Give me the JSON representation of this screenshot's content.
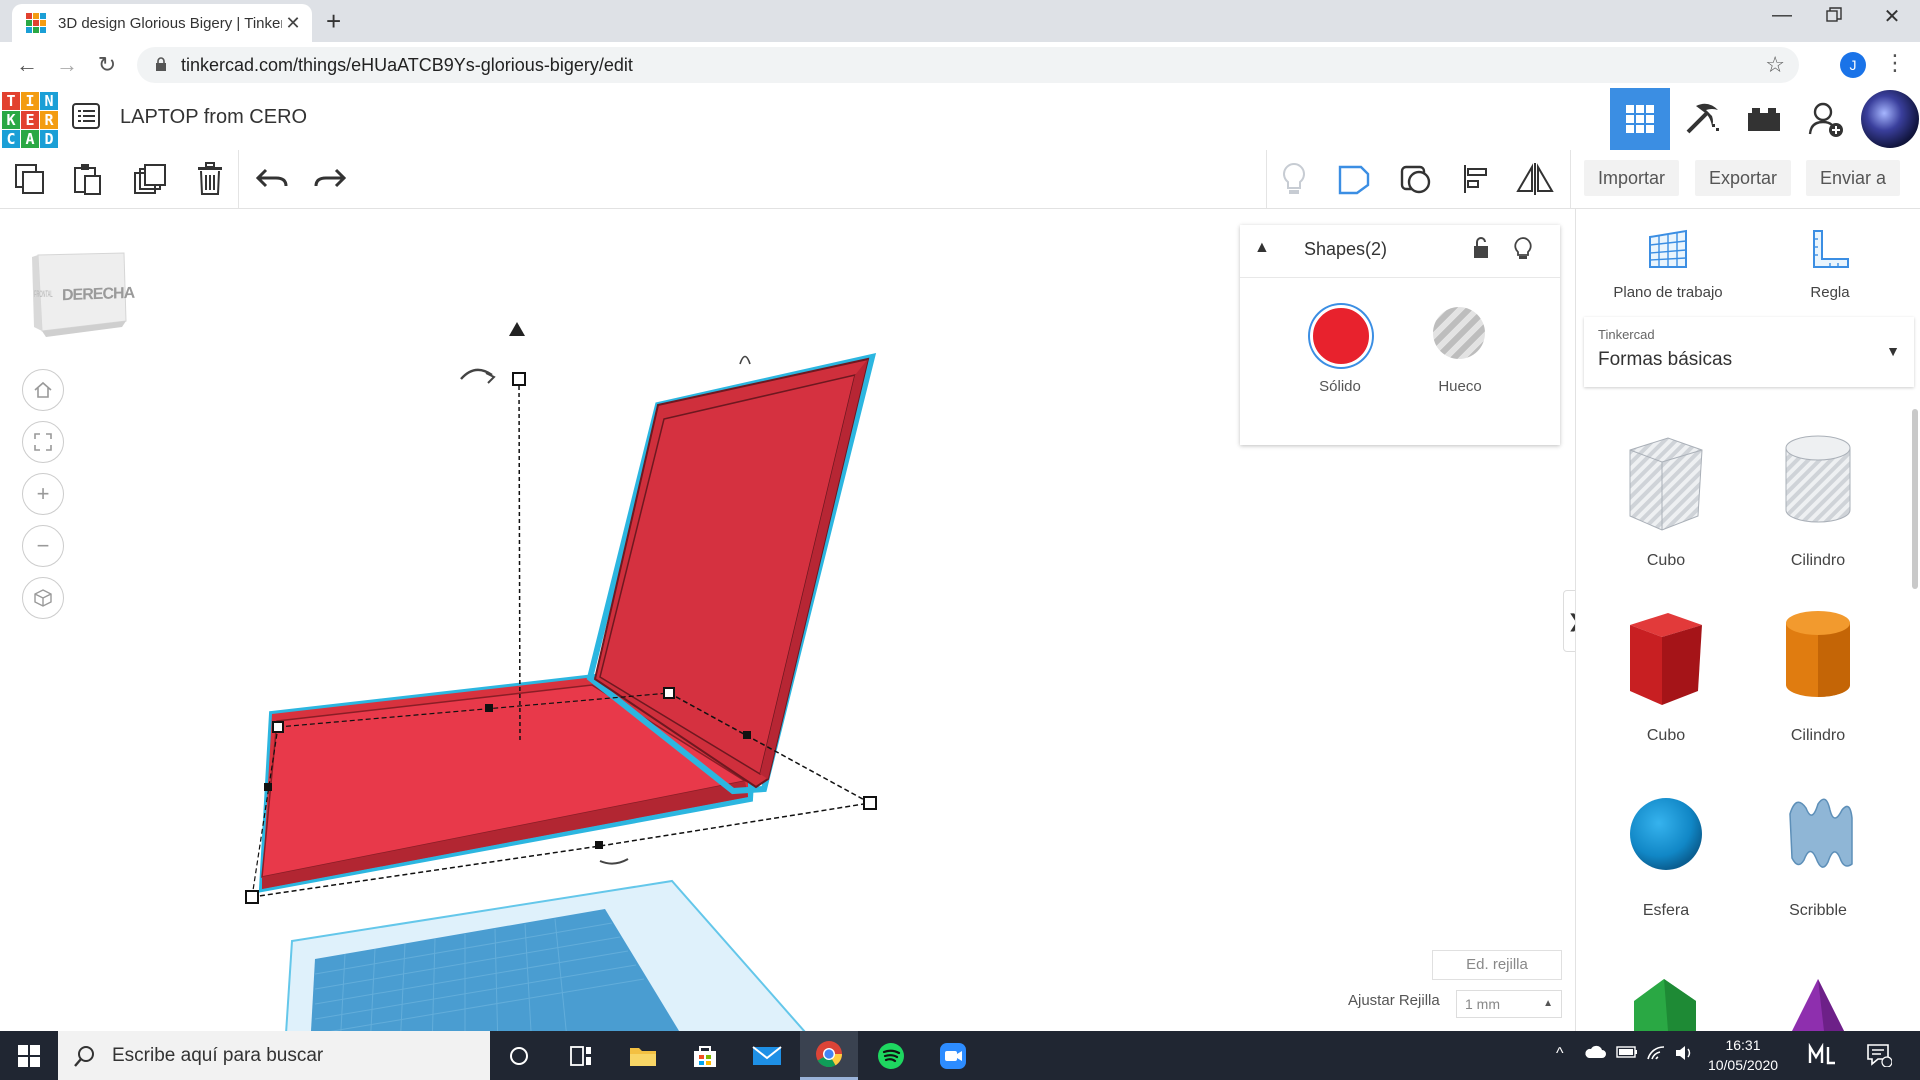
{
  "browser": {
    "tab_title": "3D design Glorious Bigery | Tinkercad",
    "url": "tinkercad.com/things/eHUaATCB9Ys-glorious-bigery/edit",
    "profile_initial": "J"
  },
  "app": {
    "logo_letters": [
      "T",
      "I",
      "N",
      "K",
      "E",
      "R",
      "C",
      "A",
      "D"
    ],
    "logo_colors": [
      "#e2412f",
      "#f39c12",
      "#1b9fd6",
      "#2aa844",
      "#e2412f",
      "#f39c12",
      "#1b9fd6",
      "#2aa844",
      "#1b9fd6"
    ],
    "design_title": "LAPTOP from CERO"
  },
  "toolbar": {
    "import_label": "Importar",
    "export_label": "Exportar",
    "send_label": "Enviar a"
  },
  "viewcube": {
    "face_label": "DERECHA",
    "side_label": "FRONTAL"
  },
  "inspector": {
    "title": "Shapes(2)",
    "solid_label": "Sólido",
    "hole_label": "Hueco",
    "solid_color": "#e8222d"
  },
  "right_panel": {
    "workplane_label": "Plano de trabajo",
    "ruler_label": "Regla",
    "library_source": "Tinkercad",
    "library_name": "Formas básicas",
    "shapes": [
      {
        "label": "Cubo",
        "kind": "box-hole"
      },
      {
        "label": "Cilindro",
        "kind": "cylinder-hole"
      },
      {
        "label": "Cubo",
        "kind": "box-red"
      },
      {
        "label": "Cilindro",
        "kind": "cylinder-orange"
      },
      {
        "label": "Esfera",
        "kind": "sphere-blue"
      },
      {
        "label": "Scribble",
        "kind": "scribble"
      }
    ]
  },
  "grid": {
    "edit_grid_label": "Ed. rejilla",
    "snap_label": "Ajustar Rejilla",
    "snap_value": "1 mm"
  },
  "taskbar": {
    "search_placeholder": "Escribe aquí para buscar",
    "time": "16:31",
    "date": "10/05/2020"
  }
}
